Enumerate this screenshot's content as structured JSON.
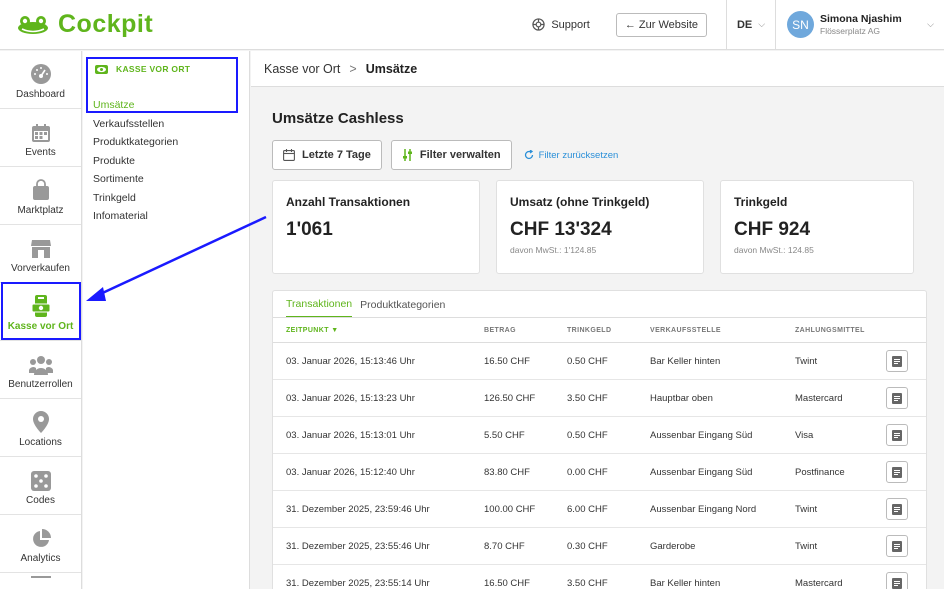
{
  "app": {
    "name": "Cockpit"
  },
  "header": {
    "support_label": "Support",
    "website_label": "← Zur Website",
    "language": "DE",
    "user": {
      "initials": "SN",
      "name": "Simona Njashim",
      "company": "Flösserplatz AG"
    }
  },
  "nav": {
    "items": [
      {
        "label": "Dashboard",
        "icon": "gauge-icon"
      },
      {
        "label": "Events",
        "icon": "calendar-icon"
      },
      {
        "label": "Marktplatz",
        "icon": "shopping-bag-icon"
      },
      {
        "label": "Vorverkaufen",
        "icon": "storefront-icon"
      },
      {
        "label": "Kasse vor Ort",
        "icon": "payment-terminal-icon",
        "active": true
      },
      {
        "label": "Benutzerrollen",
        "icon": "users-icon"
      },
      {
        "label": "Locations",
        "icon": "location-pin-icon"
      },
      {
        "label": "Codes",
        "icon": "dice-icon"
      },
      {
        "label": "Analytics",
        "icon": "pie-chart-icon"
      }
    ]
  },
  "subnav": {
    "title": "KASSE VOR ORT",
    "items": [
      "Umsätze",
      "Verkaufsstellen",
      "Produktkategorien",
      "Produkte",
      "Sortimente",
      "Trinkgeld",
      "Infomaterial"
    ]
  },
  "breadcrumb": {
    "parent": "Kasse vor Ort",
    "separator": ">",
    "current": "Umsätze"
  },
  "page": {
    "title": "Umsätze Cashless",
    "filters": {
      "date_range": "Letzte 7 Tage",
      "manage": "Filter verwalten",
      "reset": "Filter zurücksetzen"
    }
  },
  "cards": [
    {
      "label": "Anzahl Transaktionen",
      "value": "1'061",
      "sub": ""
    },
    {
      "label": "Umsatz (ohne Trinkgeld)",
      "value": "CHF 13'324",
      "sub": "davon MwSt.: 1'124.85"
    },
    {
      "label": "Trinkgeld",
      "value": "CHF 924",
      "sub": "davon MwSt.: 124.85"
    }
  ],
  "tabs": [
    "Transaktionen",
    "Produktkategorien"
  ],
  "table": {
    "columns": [
      "ZEITPUNKT",
      "BETRAG",
      "TRINKGELD",
      "VERKAUFSSTELLE",
      "ZAHLUNGSMITTEL"
    ],
    "sort_indicator": "▼",
    "rows": [
      [
        "03. Januar 2026, 15:13:46 Uhr",
        "16.50 CHF",
        "0.50 CHF",
        "Bar Keller hinten",
        "Twint"
      ],
      [
        "03. Januar 2026, 15:13:23 Uhr",
        "126.50 CHF",
        "3.50 CHF",
        "Hauptbar oben",
        "Mastercard"
      ],
      [
        "03. Januar 2026, 15:13:01 Uhr",
        "5.50 CHF",
        "0.50 CHF",
        "Aussenbar Eingang Süd",
        "Visa"
      ],
      [
        "03. Januar 2026, 15:12:40 Uhr",
        "83.80 CHF",
        "0.00 CHF",
        "Aussenbar Eingang Süd",
        "Postfinance"
      ],
      [
        "31. Dezember 2025, 23:59:46 Uhr",
        "100.00 CHF",
        "6.00 CHF",
        "Aussenbar Eingang Nord",
        "Twint"
      ],
      [
        "31. Dezember 2025, 23:55:46 Uhr",
        "8.70 CHF",
        "0.30 CHF",
        "Garderobe",
        "Twint"
      ],
      [
        "31. Dezember 2025, 23:55:14 Uhr",
        "16.50 CHF",
        "3.50 CHF",
        "Bar Keller hinten",
        "Mastercard"
      ]
    ]
  },
  "colors": {
    "brand": "#5fb51c",
    "link": "#2a8fd8",
    "highlight": "#1a1aff"
  }
}
